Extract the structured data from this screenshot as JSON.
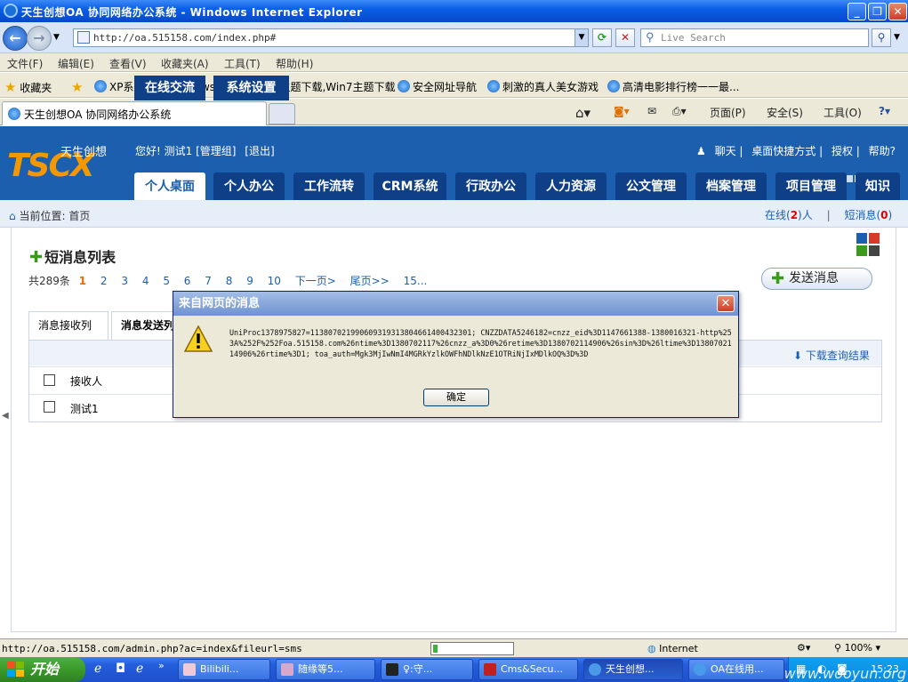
{
  "window": {
    "title": "天生创想OA 协同网络办公系统 - Windows Internet Explorer",
    "address": "http://oa.515158.com/index.php#",
    "search_placeholder": "Live Search",
    "menu": [
      "文件(F)",
      "编辑(E)",
      "查看(V)",
      "收藏夹(A)",
      "工具(T)",
      "帮助(H)"
    ],
    "favorites_label": "收藏夹",
    "favorites": [
      "XP系统下载,windows7系...",
      "XP主题下载,Win7主题下载",
      "安全网址导航",
      "刺激的真人美女游戏",
      "高清电影排行榜一一最..."
    ],
    "tab_title": "天生创想OA 协同网络办公系统",
    "cmd_page": "页面(P)",
    "cmd_safety": "安全(S)",
    "cmd_tools": "工具(O)"
  },
  "app": {
    "logo_text": "TSCX",
    "logo_cn": "天生创想",
    "greeting": "您好! 测试1 [管理组]",
    "logout": "[退出]",
    "top_links": [
      "聊天",
      "桌面快捷方式",
      "授权",
      "帮助?"
    ],
    "nav": [
      "个人桌面",
      "个人办公",
      "工作流转",
      "CRM系统",
      "行政办公",
      "人力资源",
      "公文管理",
      "档案管理",
      "项目管理",
      "知识"
    ],
    "nav2": [
      "在线交流",
      "系统设置"
    ],
    "crumb_label": "当前位置:",
    "crumb_page": "首页",
    "online_prefix": "在线(",
    "online_count": "2",
    "online_suffix": ")人",
    "msg_prefix": "短消息(",
    "msg_count": "0",
    "msg_suffix": ")"
  },
  "content": {
    "page_title": "短消息列表",
    "total": "共289条",
    "current_page": "1",
    "pages": [
      "2",
      "3",
      "4",
      "5",
      "6",
      "7",
      "8",
      "9",
      "10"
    ],
    "next": "下一页>",
    "last": "尾页>>",
    "last_page": "15...",
    "send_button": "发送消息",
    "tabs": [
      "消息接收列表",
      "消息发送列"
    ],
    "download": "下载查询结果",
    "col_receiver": "接收人",
    "row1_receiver": "测试1"
  },
  "dialog": {
    "title": "来自网页的消息",
    "message": "UniProc1378975827=113807021990609319313804661400432301; CNZZDATA5246182=cnzz_eid%3D1147661388-1380016321-http%253A%252F%252Foa.515158.com%26ntime%3D1380702117%26cnzz_a%3D0%26retime%3D1380702114906%26sin%3D%26ltime%3D1380702114906%26rtime%3D1; toa_auth=Mgk3MjIwNmI4MGRkYzlkOWFhNDlkNzE1OTRiNjIxMDlkOQ%3D%3D",
    "ok": "确定"
  },
  "status": {
    "url": "http://oa.515158.com/admin.php?ac=index&fileurl=sms",
    "zone": "Internet",
    "zoom": "100%",
    "progress": 0.06
  },
  "taskbar": {
    "start": "开始",
    "tasks": [
      "Bilibili...",
      "随缘等5...",
      "♀:守...",
      "Cms&Secu...",
      "天生创想...",
      "OA在线用..."
    ],
    "clock": "15:23",
    "watermark": "www.wooyun.org"
  },
  "colors": {
    "header_blue": "#1c5fae",
    "nav_dark": "#0f3f86",
    "accent_orange": "#e86a00"
  }
}
